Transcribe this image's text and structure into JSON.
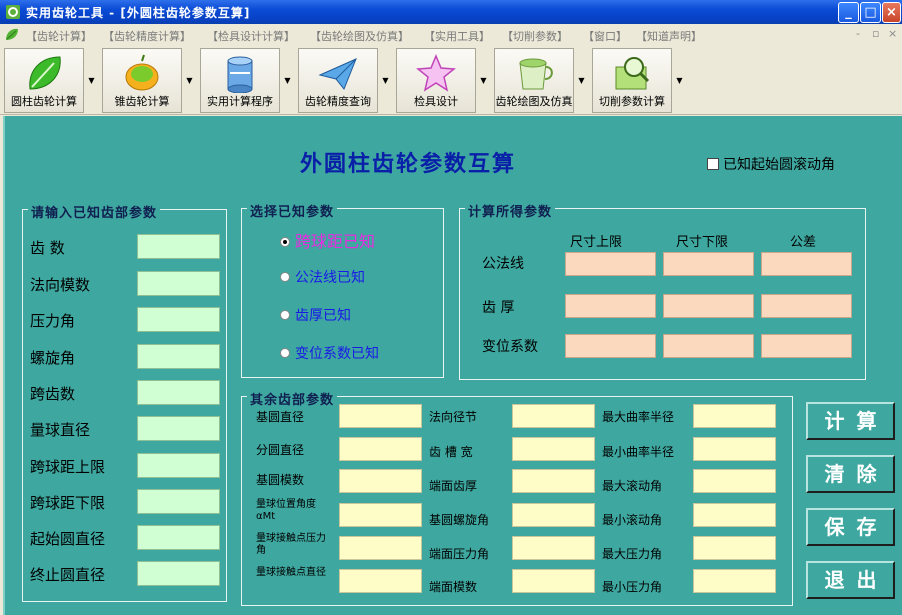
{
  "window": {
    "title": "实用齿轮工具 - [外圆柱齿轮参数互算]",
    "minimize": "_",
    "maximize": "□",
    "close": "×"
  },
  "menu": {
    "items": [
      "【齿轮计算】",
      "【齿轮精度计算】",
      "【检具设计计算】",
      "【齿轮绘图及仿真】",
      "【实用工具】",
      "【切削参数】",
      "【窗口】",
      "【知道声明】"
    ],
    "window_controls": [
      "-",
      "▫",
      "×"
    ]
  },
  "toolbar": {
    "items": [
      {
        "label": "圆柱齿轮计算",
        "icon": "green-leaf-icon"
      },
      {
        "label": "锥齿轮计算",
        "icon": "fruit-icon"
      },
      {
        "label": "实用计算程序",
        "icon": "database-icon"
      },
      {
        "label": "齿轮精度查询",
        "icon": "paper-plane-icon"
      },
      {
        "label": "检具设计",
        "icon": "star-icon"
      },
      {
        "label": "齿轮绘图及仿真",
        "icon": "cup-icon"
      },
      {
        "label": "切削参数计算",
        "icon": "magnifier-book-icon"
      }
    ],
    "dropdown_arrow": "▼"
  },
  "form": {
    "title": "外圆柱齿轮参数互算",
    "checkbox_label": "已知起始圆滚动角",
    "known_params": {
      "title": "请输入已知齿部参数",
      "fields": [
        "齿    数",
        "法向模数",
        "压力角",
        "螺旋角",
        "跨齿数",
        "量球直径",
        "跨球距上限",
        "跨球距下限",
        "起始圆直径",
        "终止圆直径"
      ]
    },
    "select_known": {
      "title": "选择已知参数",
      "options": [
        "跨球距已知",
        "公法线已知",
        "齿厚已知",
        "变位系数已知"
      ]
    },
    "computed": {
      "title": "计算所得参数",
      "columns": [
        "尺寸上限",
        "尺寸下限",
        "公差"
      ],
      "rows": [
        "公法线",
        "齿  厚",
        "变位系数"
      ]
    },
    "other": {
      "title": "其余齿部参数",
      "col1": [
        "基圆直径",
        "分圆直径",
        "基圆模数",
        "量球位置角度αMt",
        "量球接触点压力角",
        "量球接触点直径"
      ],
      "col2": [
        "法向径节",
        "齿 槽 宽",
        "端面齿厚",
        "基圆螺旋角",
        "端面压力角",
        "端面模数"
      ],
      "col3": [
        "最大曲率半径",
        "最小曲率半径",
        "最大滚动角",
        "最小滚动角",
        "最大压力角",
        "最小压力角"
      ]
    },
    "buttons": {
      "calc": "计算",
      "clear": "清除",
      "save": "保存",
      "exit": "退出"
    }
  }
}
